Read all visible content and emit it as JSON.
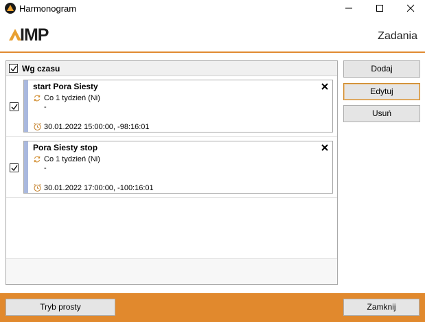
{
  "window": {
    "title": "Harmonogram",
    "accent_color": "#e1892d"
  },
  "header": {
    "logo_text": "IMP",
    "title": "Zadania"
  },
  "list": {
    "group_label": "Wg czasu",
    "group_checked": true,
    "tasks": [
      {
        "title": "start Pora Siesty",
        "repeat": "Co 1 tydzień (Ni)",
        "detail": "-",
        "time": "30.01.2022 15:00:00, -98:16:01",
        "checked": true
      },
      {
        "title": "Pora Siesty stop",
        "repeat": "Co 1 tydzień (Ni)",
        "detail": "-",
        "time": "30.01.2022 17:00:00, -100:16:01",
        "checked": true
      }
    ]
  },
  "buttons": {
    "add": "Dodaj",
    "edit": "Edytuj",
    "remove": "Usuń",
    "simple_mode": "Tryb prosty",
    "close": "Zamknij"
  },
  "icons": {
    "app": "aimp-logo-icon",
    "repeat": "repeat-icon",
    "alarm": "alarm-clock-icon",
    "delete": "close-icon"
  }
}
